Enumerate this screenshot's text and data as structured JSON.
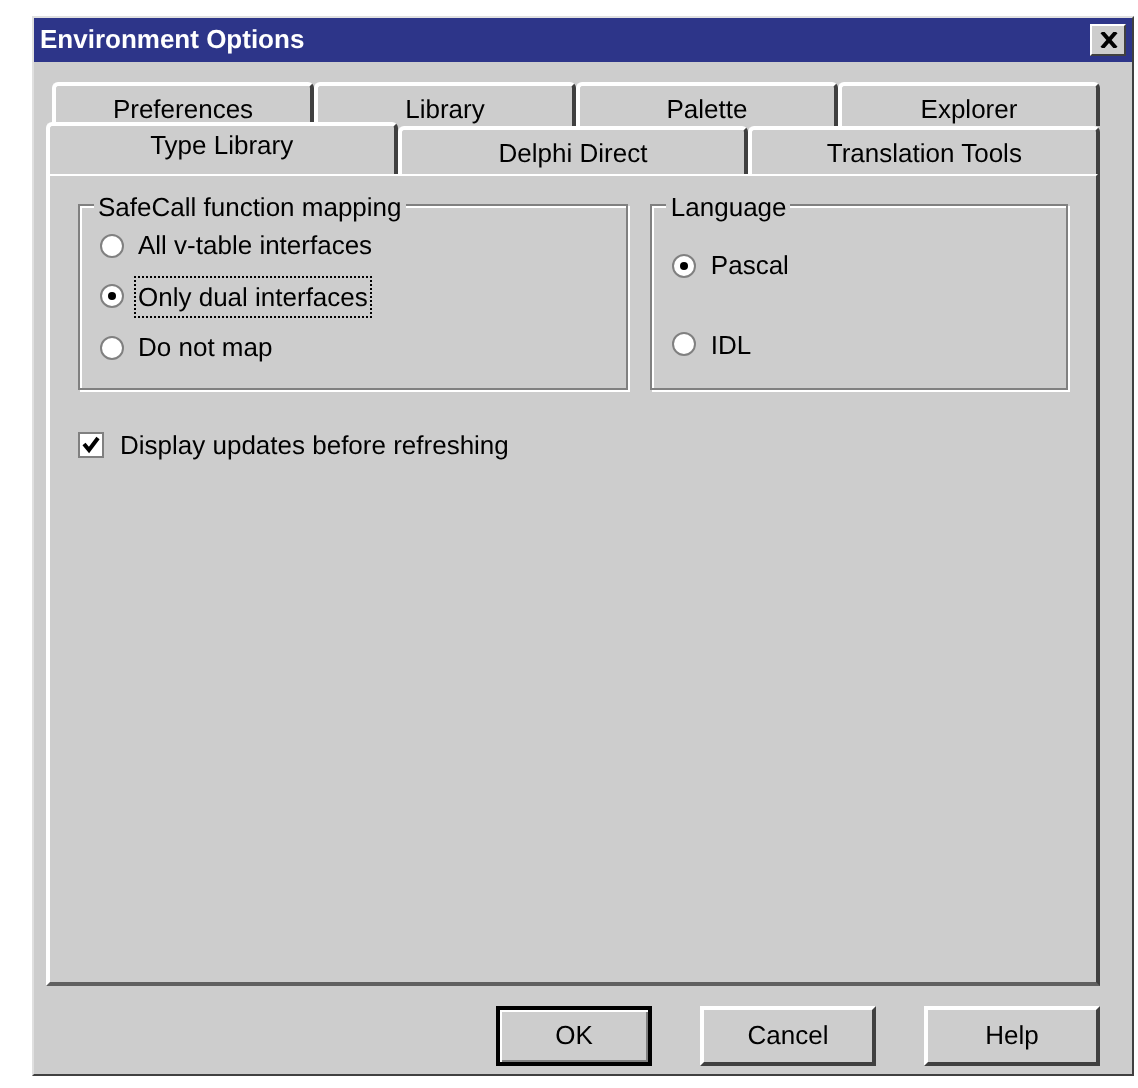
{
  "window": {
    "title": "Environment Options"
  },
  "tabs_back_row": [
    {
      "label": "Preferences",
      "selected": false
    },
    {
      "label": "Library",
      "selected": false
    },
    {
      "label": "Palette",
      "selected": false
    },
    {
      "label": "Explorer",
      "selected": false
    }
  ],
  "tabs_front_row": [
    {
      "label": "Type Library",
      "selected": true
    },
    {
      "label": "Delphi Direct",
      "selected": false
    },
    {
      "label": "Translation Tools",
      "selected": false
    }
  ],
  "safecall_group": {
    "title": "SafeCall function mapping",
    "options": [
      {
        "label": "All v-table interfaces",
        "selected": false,
        "focused": false
      },
      {
        "label": "Only dual interfaces",
        "selected": true,
        "focused": true
      },
      {
        "label": "Do not map",
        "selected": false,
        "focused": false
      }
    ]
  },
  "language_group": {
    "title": "Language",
    "options": [
      {
        "label": "Pascal",
        "selected": true,
        "focused": false
      },
      {
        "label": "IDL",
        "selected": false,
        "focused": false
      }
    ]
  },
  "display_updates": {
    "label": "Display updates before refreshing",
    "checked": true
  },
  "buttons": [
    {
      "label": "OK",
      "default": true
    },
    {
      "label": "Cancel",
      "default": false
    },
    {
      "label": "Help",
      "default": false
    }
  ]
}
